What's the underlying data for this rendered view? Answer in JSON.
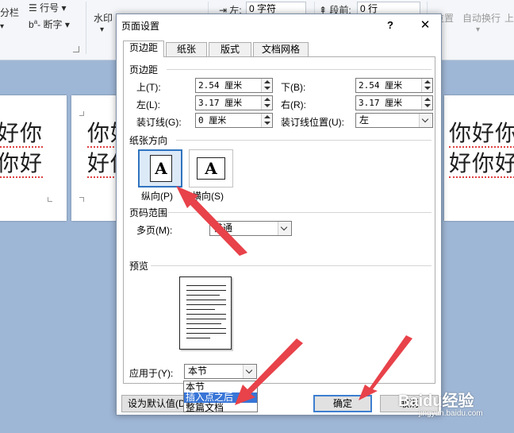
{
  "ribbon": {
    "columns_label": "分栏",
    "line_numbers_label": "行号",
    "hyphenation_label": "断字",
    "watermark_label": "水印",
    "indent_left_label": "左:",
    "indent_left_value": "0 字符",
    "spacing_before_label": "段前:",
    "spacing_before_value": "0 行",
    "position_label": "位置",
    "wrap_text_label": "自动换行",
    "right_partial": "上"
  },
  "document": {
    "left_page_lines": [
      "好你",
      "你好"
    ],
    "middle_page_lines": [
      "你好",
      "好你"
    ],
    "right_page_lines": [
      "你好你",
      "好你好"
    ]
  },
  "dialog": {
    "title": "页面设置",
    "help": "?",
    "close": "✕",
    "tabs": [
      "页边距",
      "纸张",
      "版式",
      "文档网格"
    ],
    "margins": {
      "section": "页边距",
      "top_label": "上(T):",
      "top_value": "2.54 厘米",
      "bottom_label": "下(B):",
      "bottom_value": "2.54 厘米",
      "left_label": "左(L):",
      "left_value": "3.17 厘米",
      "right_label": "右(R):",
      "right_value": "3.17 厘米",
      "gutter_label": "装订线(G):",
      "gutter_value": "0 厘米",
      "gutter_pos_label": "装订线位置(U):",
      "gutter_pos_value": "左"
    },
    "orientation": {
      "section": "纸张方向",
      "portrait_label": "纵向(P)",
      "landscape_label": "横向(S)",
      "glyph": "A",
      "selected": "portrait"
    },
    "pages": {
      "section": "页码范围",
      "multiple_label": "多页(M):",
      "multiple_value": "普通"
    },
    "preview": {
      "section": "预览"
    },
    "apply_to": {
      "label": "应用于(Y):",
      "value": "本节",
      "options": [
        "本节",
        "插入点之后",
        "整篇文档"
      ],
      "highlighted_index": 1
    },
    "buttons": {
      "default": "设为默认值(D)",
      "ok": "确定",
      "cancel": "取消"
    }
  },
  "watermark": {
    "brand": "Baidu经验",
    "url": "jingyan.baidu.com"
  },
  "colors": {
    "accent": "#3875d7",
    "arrow": "#e8424a",
    "doc_bg": "#9fb7d6"
  }
}
